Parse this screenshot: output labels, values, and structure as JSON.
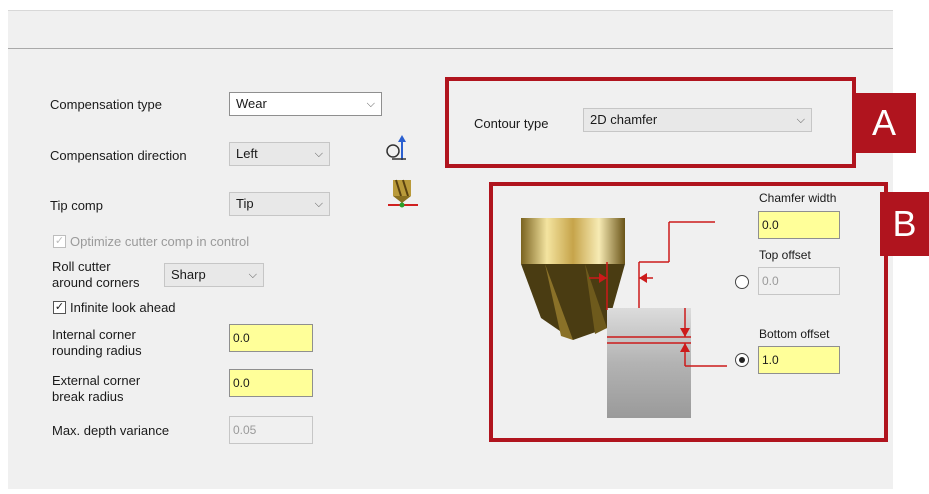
{
  "left": {
    "compensation_type": {
      "label": "Compensation type",
      "value": "Wear"
    },
    "compensation_direction": {
      "label": "Compensation direction",
      "value": "Left"
    },
    "tip_comp": {
      "label": "Tip comp",
      "value": "Tip"
    },
    "optimize": {
      "label": "Optimize cutter comp in control",
      "checked": true,
      "disabled": true
    },
    "roll_cutter": {
      "label_line1": "Roll cutter",
      "label_line2": "around corners",
      "value": "Sharp"
    },
    "infinite": {
      "label": "Infinite look ahead",
      "checked": true
    },
    "internal_corner": {
      "label_line1": "Internal corner",
      "label_line2": "rounding radius",
      "value": "0.0"
    },
    "external_corner": {
      "label_line1": "External corner",
      "label_line2": "break radius",
      "value": "0.0"
    },
    "max_depth": {
      "label": "Max. depth variance",
      "value": "0.05"
    }
  },
  "contour": {
    "label": "Contour type",
    "value": "2D chamfer"
  },
  "chamfer": {
    "width": {
      "label": "Chamfer width",
      "value": "0.0"
    },
    "top_offset": {
      "label": "Top offset",
      "value": "0.0",
      "selected": false
    },
    "bottom_offset": {
      "label": "Bottom offset",
      "value": "1.0",
      "selected": true
    }
  },
  "badges": {
    "a": "A",
    "b": "B"
  },
  "icons": {
    "check": "✓",
    "chevron": "⌵"
  },
  "colors": {
    "highlight_red": "#b0141e",
    "input_yellow": "#ffff99"
  }
}
